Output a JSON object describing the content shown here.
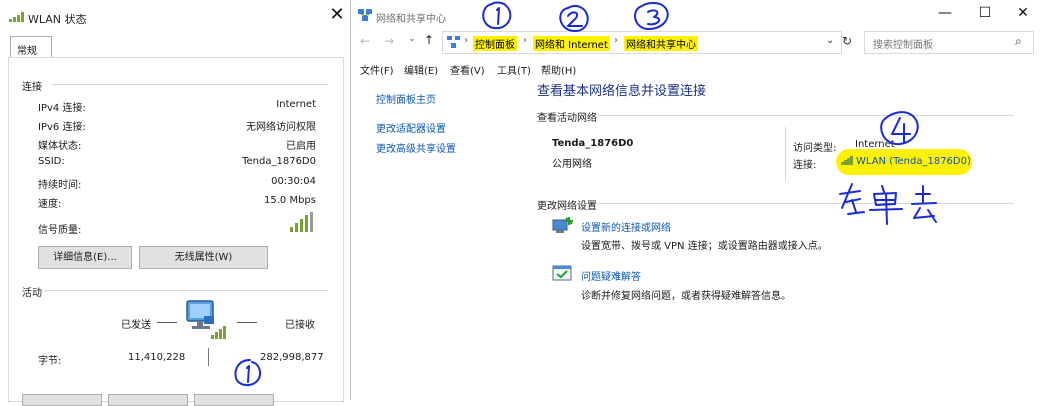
{
  "wlan_dialog": {
    "title": "WLAN 状态",
    "tab": "常规",
    "connection_section": "连接",
    "rows": [
      {
        "label": "IPv4 连接:",
        "value": "Internet"
      },
      {
        "label": "IPv6 连接:",
        "value": "无网络访问权限"
      },
      {
        "label": "媒体状态:",
        "value": "已启用"
      },
      {
        "label": "SSID:",
        "value": "Tenda_1876D0"
      },
      {
        "label": "持续时间:",
        "value": "00:30:04"
      },
      {
        "label": "速度:",
        "value": "15.0 Mbps"
      }
    ],
    "signal_label": "信号质量:",
    "signal_bars": 4,
    "details_button": "详细信息(E)...",
    "wireless_props_button": "无线属性(W)",
    "activity_section": "活动",
    "sent_label": "已发送",
    "received_label": "已接收",
    "bytes_label": "字节:",
    "bytes_sent": "11,410,228",
    "bytes_received": "282,998,877"
  },
  "nsc": {
    "title": "网络和共享中心",
    "breadcrumbs": [
      "控制面板",
      "网络和 Internet",
      "网络和共享中心"
    ],
    "search_placeholder": "搜索控制面板",
    "menu": [
      "文件(F)",
      "编辑(E)",
      "查看(V)",
      "工具(T)",
      "帮助(H)"
    ],
    "left_nav": [
      "控制面板主页",
      "更改适配器设置",
      "更改高级共享设置"
    ],
    "heading": "查看基本网络信息并设置连接",
    "active_networks": "查看活动网络",
    "network_name": "Tenda_1876D0",
    "network_type": "公用网络",
    "access_type_label": "访问类型:",
    "access_type_value": "Internet",
    "connections_label": "连接:",
    "connection_link": "WLAN (Tenda_1876D0)",
    "change_settings": "更改网络设置",
    "tasks": [
      {
        "title": "设置新的连接或网络",
        "desc": "设置宽带、拨号或 VPN 连接；或设置路由器或接入点。"
      },
      {
        "title": "问题疑难解答",
        "desc": "诊断并修复网络问题，或者获得疑难解答信息。"
      }
    ]
  },
  "colors": {
    "link": "#0a57b5",
    "highlight": "#fff200",
    "signal": "#7aa233",
    "annotation": "#1a2bd6"
  }
}
